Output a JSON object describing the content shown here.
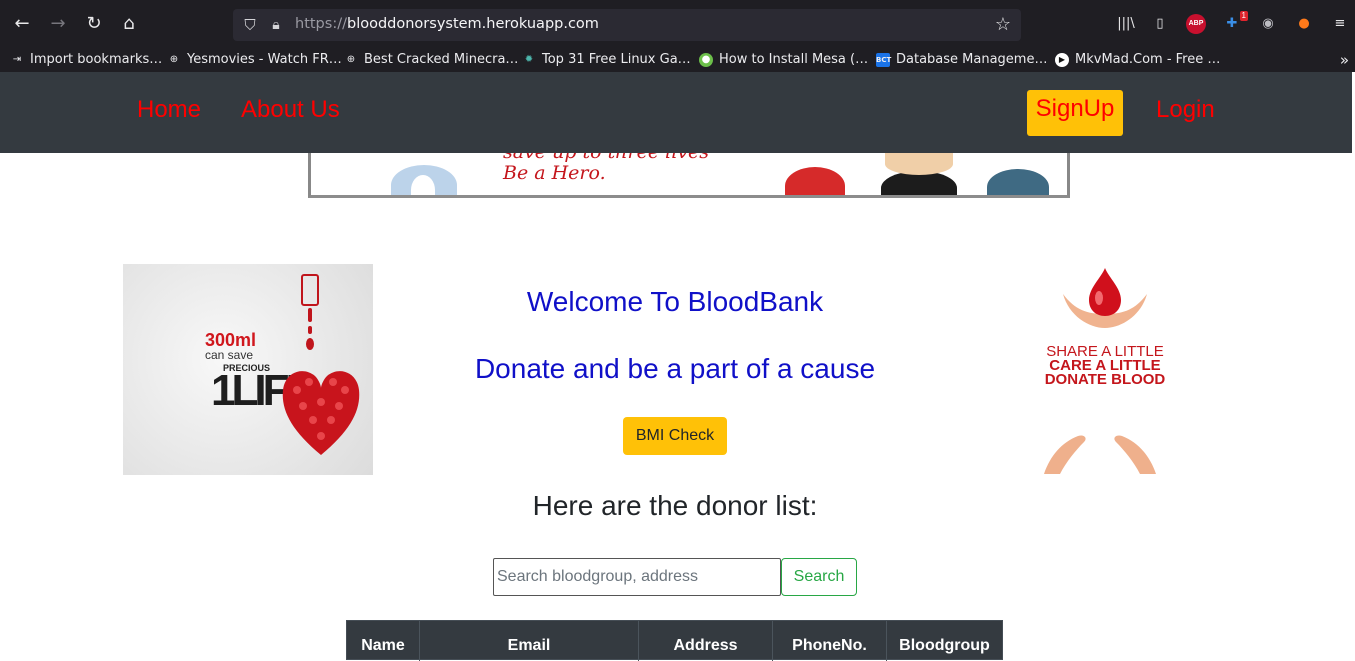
{
  "browser": {
    "url_prefix": "https://",
    "url_host": "blooddonorsystem.herokuapp.com",
    "icons": [
      "back-icon",
      "forward-icon",
      "reload-icon",
      "home-icon",
      "shield-icon",
      "lock-icon",
      "star-icon",
      "library-icon",
      "sidebar-icon",
      "adblock-icon",
      "extension-icon",
      "extension-icon",
      "extension-icon",
      "menu-icon"
    ],
    "abp_label": "ABP",
    "extension_badge": "1"
  },
  "bookmarks": [
    {
      "label": "Import bookmarks…",
      "icon": "import-icon"
    },
    {
      "label": "Yesmovies - Watch FR…",
      "icon": "globe-icon"
    },
    {
      "label": "Best Cracked Minecra…",
      "icon": "globe-icon"
    },
    {
      "label": "Top 31 Free Linux Ga…",
      "icon": "site-icon"
    },
    {
      "label": "How to Install Mesa (…",
      "icon": "site-icon"
    },
    {
      "label": "Database Manageme…",
      "icon": "site-icon"
    },
    {
      "label": "MkvMad.Com - Free …",
      "icon": "site-icon"
    }
  ],
  "site_nav": {
    "home": "Home",
    "about": "About Us",
    "signup": "SignUp",
    "login": "Login"
  },
  "banner": {
    "line1": "save up to three lives",
    "line2": "Be a Hero."
  },
  "poster_left": {
    "amount": "300ml",
    "can_save": "can save",
    "precious": "PRECIOUS",
    "life": "1LIFE"
  },
  "poster_right": {
    "line1": "SHARE A LITTLE",
    "line2": "CARE A LITTLE",
    "line3": "DONATE BLOOD"
  },
  "main": {
    "welcome": "Welcome To BloodBank",
    "tagline": "Donate and be a part of a cause",
    "bmi_button": "BMI Check",
    "donor_heading": "Here are the donor list:",
    "search_placeholder": "Search bloodgroup, address",
    "search_button": "Search"
  },
  "table": {
    "headers": [
      "Name",
      "Email",
      "Address",
      "PhoneNo.",
      "Bloodgroup"
    ]
  },
  "colors": {
    "nav_bg": "#343a40",
    "nav_link": "#ff0000",
    "accent": "#ffc107",
    "heading_blue": "#1010c8",
    "search_green": "#28a745"
  }
}
